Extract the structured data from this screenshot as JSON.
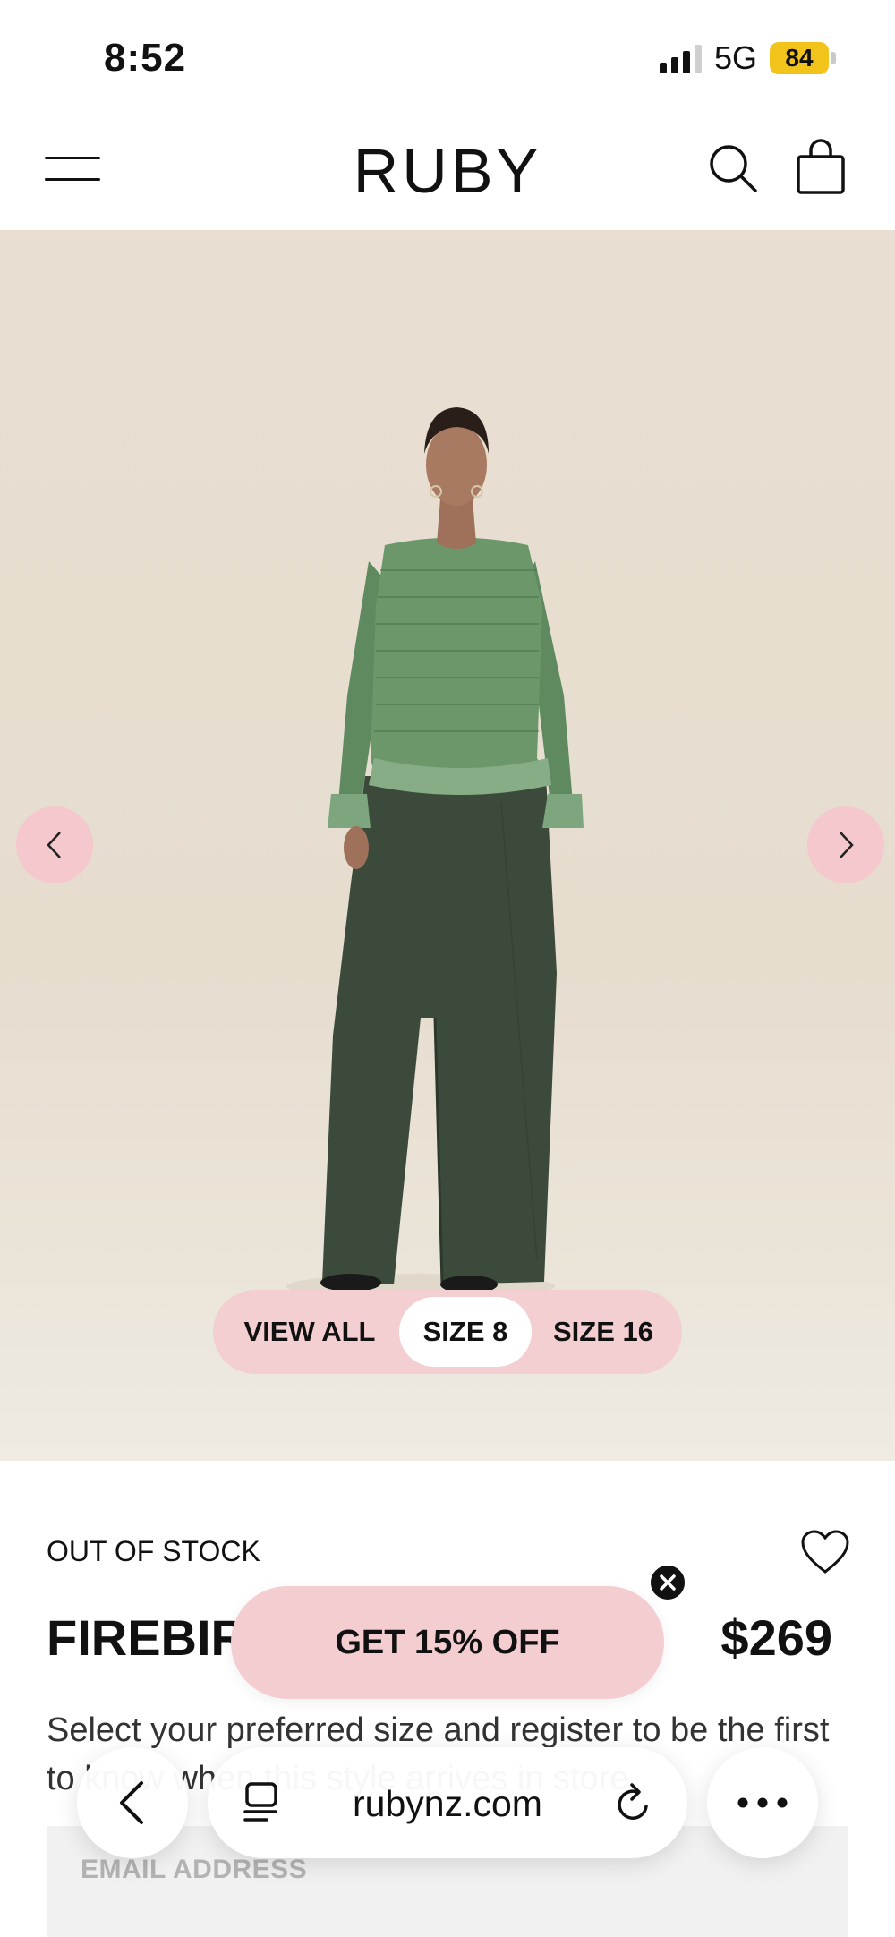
{
  "status_bar": {
    "time": "8:52",
    "network": "5G",
    "battery": "84"
  },
  "header": {
    "logo": "RUBY",
    "icons": [
      "menu-icon",
      "search-icon",
      "shopping-bag-icon"
    ]
  },
  "gallery": {
    "size_filter": {
      "options": [
        "VIEW ALL",
        "SIZE 8",
        "SIZE 16"
      ],
      "selected": "SIZE 8"
    },
    "icons": [
      "chevron-left-icon",
      "chevron-right-icon"
    ],
    "accent_color": "#f4c8cc"
  },
  "product": {
    "stock_status": "OUT OF STOCK",
    "name_visible": "FIREBIR",
    "price": "$269",
    "description": "Select your preferred size and register to be the first to know when this style arrives in store.",
    "email_placeholder": "EMAIL ADDRESS"
  },
  "promo": {
    "label": "GET 15% OFF",
    "color": "#f4cdd0"
  },
  "browser": {
    "url": "rubynz.com",
    "icons": [
      "back-arrow-icon",
      "tabs-icon",
      "reload-icon",
      "more-icon"
    ]
  }
}
